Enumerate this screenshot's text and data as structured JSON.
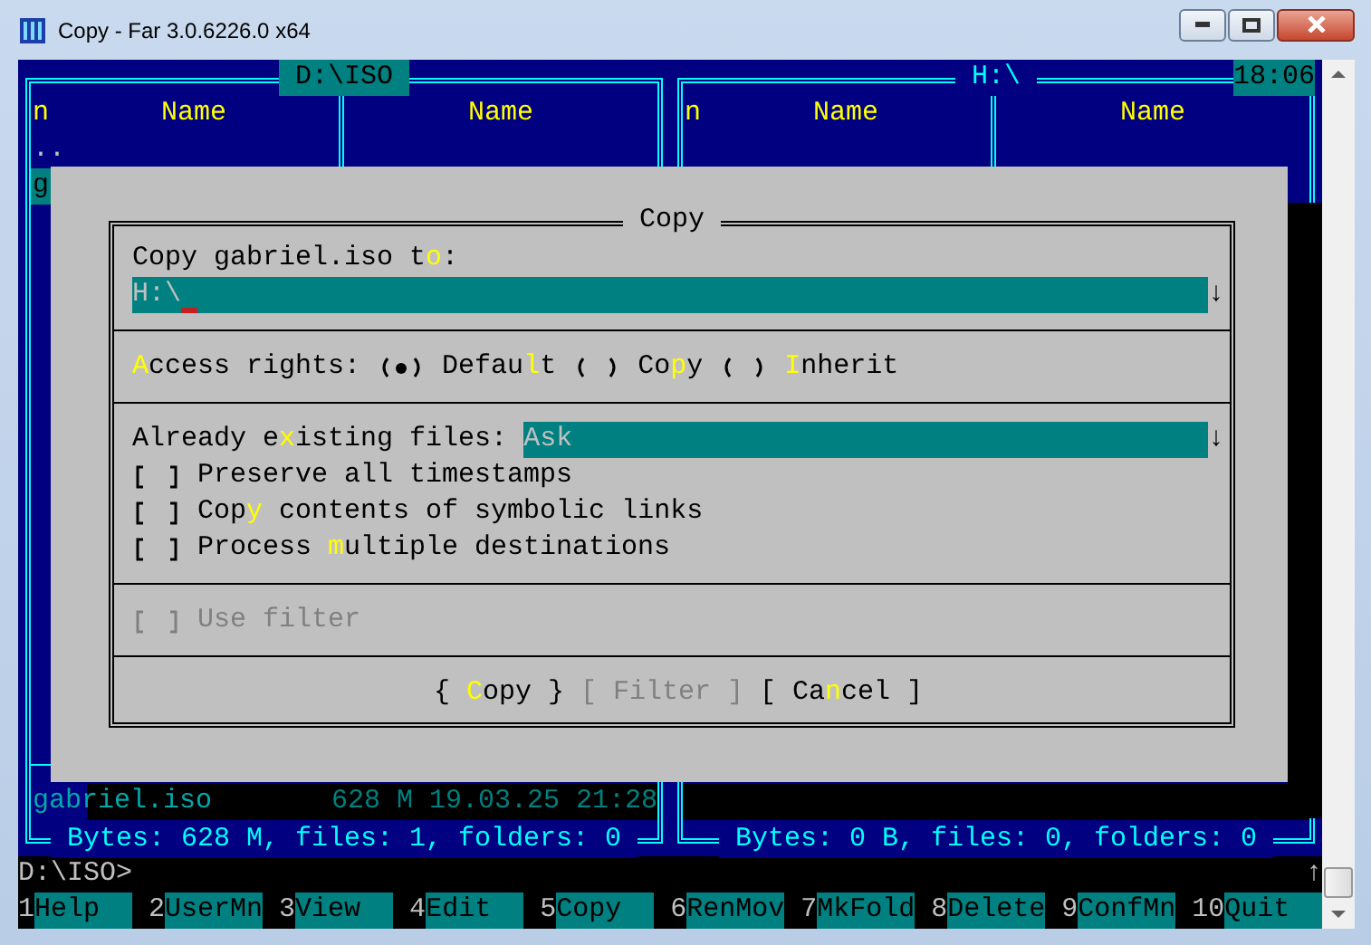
{
  "window": {
    "title": "Copy - Far 3.0.6226.0 x64"
  },
  "panels": [
    {
      "path": "D:\\ISO",
      "active": true,
      "columns": [
        "n",
        "Name",
        "Name"
      ],
      "files": [
        {
          "name": "..",
          "selected": false
        },
        {
          "name": "g",
          "selected": true
        }
      ],
      "info": {
        "name": "gabriel.iso",
        "size": "628 M",
        "date": "19.03.25",
        "time": "21:28"
      },
      "summary": "Bytes: 628 M, files: 1, folders: 0"
    },
    {
      "path": "H:\\",
      "active": false,
      "clock": "18:06",
      "columns": [
        "n",
        "Name",
        "Name"
      ],
      "summary": "Bytes: 0 B, files: 0, folders: 0"
    }
  ],
  "dialog": {
    "title": "Copy",
    "sections": [
      {
        "kind": "input",
        "label": "Copy gabriel.iso t**o**:",
        "value": "H:\\",
        "dropdown_glyph": "↓"
      },
      {
        "kind": "radio",
        "label": "**A**ccess rights:",
        "options": [
          {
            "label": "Defau**l**t",
            "selected": true
          },
          {
            "label": "Co**p**y",
            "selected": false
          },
          {
            "label": "**I**nherit",
            "selected": false
          }
        ]
      },
      {
        "kind": "options",
        "combo": {
          "label": "Already e**x**isting files:",
          "value": "Ask",
          "dropdown_glyph": "↓"
        },
        "checkboxes": [
          {
            "label": "Preserve all timestamps",
            "checked": false,
            "disabled": false
          },
          {
            "label": "Cop**y** contents of symbolic links",
            "checked": false,
            "disabled": false
          },
          {
            "label": "Process **m**ultiple destinations",
            "checked": false,
            "disabled": false
          }
        ]
      },
      {
        "kind": "checkbox",
        "checkboxes": [
          {
            "label": "Use filter",
            "checked": false,
            "disabled": true
          }
        ]
      },
      {
        "kind": "buttons",
        "buttons": [
          {
            "label": "{ **C**opy }",
            "disabled": false
          },
          {
            "label": "[ Filter ]",
            "disabled": true
          },
          {
            "label": "[ Ca**n**cel ]",
            "disabled": false
          }
        ]
      }
    ]
  },
  "command_line": {
    "prompt": "D:\\ISO>",
    "indicator": "↑"
  },
  "keybar": [
    {
      "number": "1",
      "label": "Help"
    },
    {
      "number": "2",
      "label": "UserMn"
    },
    {
      "number": "3",
      "label": "View"
    },
    {
      "number": "4",
      "label": "Edit"
    },
    {
      "number": "5",
      "label": "Copy"
    },
    {
      "number": "6",
      "label": "RenMov"
    },
    {
      "number": "7",
      "label": "MkFold"
    },
    {
      "number": "8",
      "label": "Delete"
    },
    {
      "number": "9",
      "label": "ConfMn"
    },
    {
      "number": "10",
      "label": "Quit"
    }
  ]
}
